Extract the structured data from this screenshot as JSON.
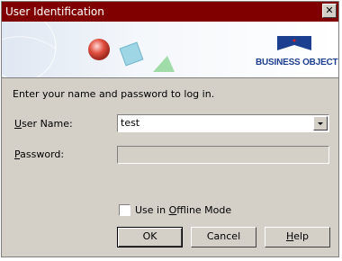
{
  "window": {
    "title": "User Identification",
    "close_glyph": "✕"
  },
  "banner": {
    "logo_text": "BUSINESS OBJECTS",
    "logo_mark": "®",
    "logo_color": "#1d3f8f"
  },
  "prompt": "Enter your name and password to log in.",
  "user_name": {
    "label": "User Name:",
    "value": "test"
  },
  "password": {
    "label": "Password:",
    "value": ""
  },
  "offline": {
    "label": "Use in Offline Mode",
    "checked": false
  },
  "buttons": {
    "ok": "OK",
    "cancel": "Cancel",
    "help": "Help"
  },
  "colors": {
    "titlebar": "#800000",
    "dialog_bg": "#d4d0c8"
  }
}
